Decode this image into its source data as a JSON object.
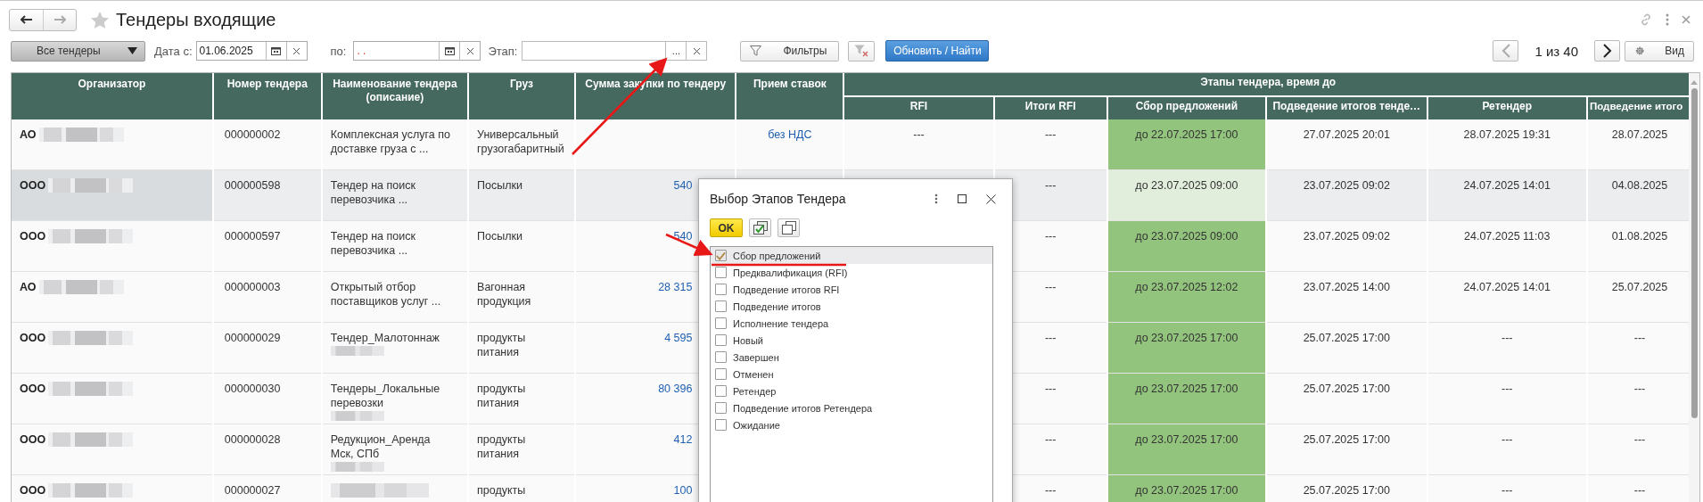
{
  "window": {
    "title": "Тендеры входящие"
  },
  "toolbar": {
    "preset": "Все тендеры",
    "date_from_label": "Дата с:",
    "date_from": "01.06.2025",
    "date_to_label": "по:",
    "date_to": ". .",
    "stage_label": "Этап:",
    "choose_button": "...",
    "filters_button": "Фильтры",
    "refresh_button": "Обновить / Найти",
    "page_info": "1 из 40",
    "view_button": "Вид"
  },
  "table": {
    "group_header": "Этапы тендера, время до",
    "columns": [
      "Организатор",
      "Номер тендера",
      "Наименование тендера\n(описание)",
      "Груз",
      "Сумма закупки по тендеру",
      "Прием ставок",
      "RFI",
      "Итоги RFI",
      "Сбор предложений",
      "Подведение итогов тенде…",
      "Ретендер",
      "Подведение итого"
    ],
    "rows": [
      {
        "selected": false,
        "organizer": "АО",
        "name_redacted": false,
        "number": "000000002",
        "name": "Комплексная услуга по\nдоставке груза с ...",
        "cargo": "Универсальный\nгрузогабаритный",
        "bids": "без НДС",
        "rfi": "---",
        "rfi_results": "---",
        "collection": "до 22.07.2025 17:00",
        "summary": "27.07.2025 20:01",
        "retender": "28.07.2025 19:31",
        "retender_summary": "28.07.2025"
      },
      {
        "selected": true,
        "organizer": "ООО",
        "name_redacted": false,
        "number": "000000598",
        "name": "Тендер на поиск\nперевозчика ...",
        "cargo": "Посылки",
        "amount": "540",
        "rfi_results": "---",
        "collection": "до 23.07.2025 09:00",
        "summary": "23.07.2025 09:02",
        "retender": "24.07.2025 14:01",
        "retender_summary": "04.08.2025"
      },
      {
        "selected": false,
        "organizer": "ООО",
        "name_redacted": false,
        "number": "000000597",
        "name": "Тендер на поиск\nперевозчика ...",
        "cargo": "Посылки",
        "amount": "540",
        "rfi_results": "---",
        "collection": "до 23.07.2025 09:00",
        "summary": "23.07.2025 09:02",
        "retender": "24.07.2025 11:03",
        "retender_summary": "01.08.2025"
      },
      {
        "selected": false,
        "organizer": "АО",
        "name_redacted": false,
        "number": "000000003",
        "name": "Открытый  отбор\nпоставщиков услуг ...",
        "cargo": "Вагонная\nпродукция",
        "amount": "28 315",
        "rfi_results": "---",
        "collection": "до 23.07.2025 12:02",
        "summary": "23.07.2025 14:00",
        "retender": "24.07.2025 14:01",
        "retender_summary": "25.07.2025"
      },
      {
        "selected": false,
        "organizer": "ООО",
        "name_redacted": true,
        "number": "000000029",
        "name": "Тендер_Малотоннаж",
        "cargo": "продукты\nпитания",
        "amount": "4 595",
        "rfi_results": "---",
        "collection": "до 23.07.2025 17:00",
        "summary": "25.07.2025 17:00",
        "retender": "---",
        "retender_summary": "---"
      },
      {
        "selected": false,
        "organizer": "ООО",
        "name_redacted": true,
        "number": "000000030",
        "name": "Тендеры_Локальные\nперевозки",
        "cargo": "продукты\nпитания",
        "amount": "80 396",
        "rfi_results": "---",
        "collection": "до 23.07.2025 17:00",
        "summary": "25.07.2025 17:00",
        "retender": "---",
        "retender_summary": "---"
      },
      {
        "selected": false,
        "organizer": "ООО",
        "name_redacted": true,
        "number": "000000028",
        "name": "Редукцион_Аренда\nМск, СПб",
        "cargo": "продукты\nпитания",
        "amount": "412",
        "rfi_results": "---",
        "collection": "до 23.07.2025 17:00",
        "summary": "25.07.2025 17:00",
        "retender": "---",
        "retender_summary": "---"
      },
      {
        "selected": false,
        "organizer": "ООО",
        "name_redacted": true,
        "number": "000000027",
        "cargo": "продукты",
        "amount": "100",
        "rfi_results": "---",
        "collection": "до 23.07.2025 17:00",
        "summary": "25.07.2025 17:00",
        "retender": "---",
        "retender_summary": "---"
      }
    ]
  },
  "dialog": {
    "title": "Выбор Этапов Тендера",
    "ok_button": "OK",
    "stages": [
      {
        "label": "Сбор предложений",
        "checked": true,
        "selected": true
      },
      {
        "label": "Предквалификация (RFI)",
        "checked": false,
        "selected": false
      },
      {
        "label": "Подведение итогов RFI",
        "checked": false,
        "selected": false
      },
      {
        "label": "Подведение итогов",
        "checked": false,
        "selected": false
      },
      {
        "label": "Исполнение тендера",
        "checked": false,
        "selected": false
      },
      {
        "label": "Новый",
        "checked": false,
        "selected": false
      },
      {
        "label": "Завершен",
        "checked": false,
        "selected": false
      },
      {
        "label": "Отменен",
        "checked": false,
        "selected": false
      },
      {
        "label": "Ретендер",
        "checked": false,
        "selected": false
      },
      {
        "label": "Подведение итогов Ретендера",
        "checked": false,
        "selected": false
      },
      {
        "label": "Ожидание",
        "checked": false,
        "selected": false
      }
    ]
  }
}
